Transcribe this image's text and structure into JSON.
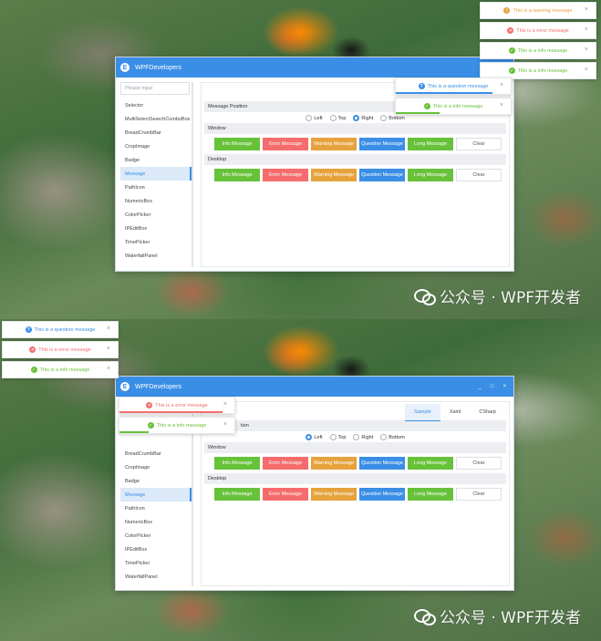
{
  "window": {
    "title": "WPFDevelopers",
    "logo_letter": "E",
    "controls": [
      "_",
      "□",
      "×"
    ]
  },
  "sidebar": {
    "search_placeholder": "Please input",
    "items": [
      "Selector",
      "MultiSelectSearchComboBox",
      "BreadCrumbBar",
      "CropImage",
      "Badge",
      "Message",
      "PathIcon",
      "NumericBox",
      "ColorPicker",
      "IPEditBox",
      "TimePicker",
      "WaterfallPanel"
    ],
    "active_index": 5
  },
  "tabs": [
    "Sample",
    "Xaml",
    "CSharp"
  ],
  "panel": {
    "position_header": "Message Position",
    "position_header_partial": "tion",
    "position_options": [
      "Left",
      "Top",
      "Right",
      "Bottom"
    ],
    "window_header": "Window",
    "desktop_header": "Desktop",
    "buttons": [
      "Info Message",
      "Error Message",
      "Warning Message",
      "Question Message",
      "Long Message",
      "Clear"
    ]
  },
  "screen1": {
    "selected_position": "Right",
    "toasts": [
      {
        "type": "warn",
        "text": "This is a warning message"
      },
      {
        "type": "error",
        "text": "This is a error message"
      },
      {
        "type": "info",
        "text": "This is a info message"
      },
      {
        "type": "info",
        "text": "This is a info message"
      },
      {
        "type": "question",
        "text": "This is a question message"
      },
      {
        "type": "info",
        "text": "This is a info message"
      }
    ]
  },
  "screen2": {
    "selected_position": "Left",
    "toasts": [
      {
        "type": "question",
        "text": "This is a question message"
      },
      {
        "type": "error",
        "text": "This is a error message"
      },
      {
        "type": "info",
        "text": "This is a info message"
      },
      {
        "type": "error",
        "text": "This is a error message"
      },
      {
        "type": "info",
        "text": "This is a info message"
      }
    ]
  },
  "watermark": "公众号 · WPF开发者",
  "colors": {
    "titlebar": "#3a8ee6",
    "info": "#67c23a",
    "error": "#f56c6c",
    "warning": "#e6a23c",
    "question": "#3a8ee6"
  }
}
